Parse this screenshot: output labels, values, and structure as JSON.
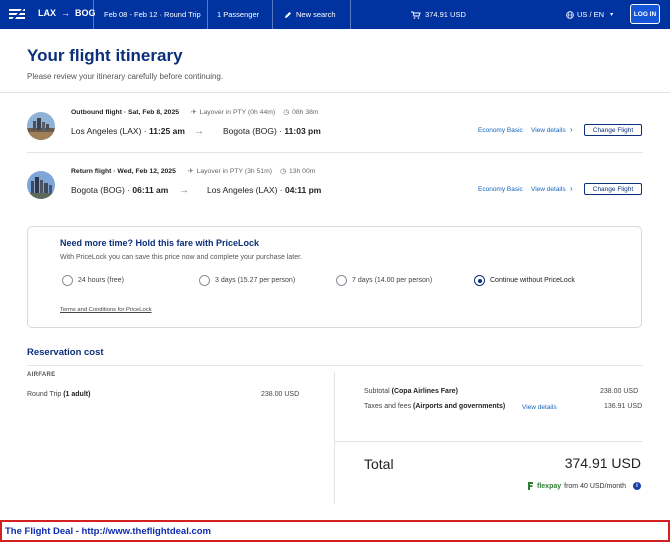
{
  "header": {
    "origin": "LAX",
    "destination": "BOG",
    "dates": "Feb 08 - Feb 12 · Round Trip",
    "passengers": "1 Passenger",
    "new_search": "New search",
    "cart_total": "374.91 USD",
    "locale": "US / EN",
    "login": "LOG IN"
  },
  "page": {
    "title": "Your flight itinerary",
    "subtitle": "Please review your itinerary carefully before continuing."
  },
  "flights": [
    {
      "label": "Outbound flight · Sat, Feb 8, 2025",
      "layover": "Layover in PTY (0h 44m)",
      "duration": "08h 38m",
      "depart": "Los Angeles (LAX) · ",
      "depart_time": "11:25 am",
      "arrive": "Bogota (BOG) · ",
      "arrive_time": "11:03 pm",
      "fare": "Economy Basic",
      "view_details": "View details",
      "change": "Change Flight"
    },
    {
      "label": "Return flight · Wed, Feb 12, 2025",
      "layover": "Layover in PTY (3h 51m)",
      "duration": "13h 00m",
      "depart": "Bogota (BOG) · ",
      "depart_time": "06:11 am",
      "arrive": "Los Angeles (LAX) · ",
      "arrive_time": "04:11 pm",
      "fare": "Economy Basic",
      "view_details": "View details",
      "change": "Change Flight"
    }
  ],
  "pricelock": {
    "title": "Need more time? Hold this fare with PriceLock",
    "subtitle": "With PriceLock you can save this price now and complete your purchase later.",
    "options": [
      {
        "label": "24 hours (free)",
        "selected": false
      },
      {
        "label": "3 days (15.27 per person)",
        "selected": false
      },
      {
        "label": "7 days (14.00 per person)",
        "selected": false
      },
      {
        "label": "Continue without PriceLock",
        "selected": true
      }
    ],
    "terms": "Terms and Conditions for PriceLock"
  },
  "reservation": {
    "title": "Reservation cost",
    "airfare_heading": "AIRFARE",
    "round_trip_label": "Round Trip",
    "round_trip_qty": "(1 adult)",
    "round_trip_price": "238.00 USD",
    "subtotal_label": "Subtotal",
    "subtotal_note": "(Copa Airlines Fare)",
    "subtotal_price": "238.00 USD",
    "taxes_label": "Taxes and fees",
    "taxes_note": "(Airports and governments)",
    "taxes_view": "View details",
    "taxes_price": "136.91 USD",
    "total_label": "Total",
    "total_price": "374.91 USD",
    "flexpay_brand": "flexpay",
    "flexpay_text": "from 40 USD/month"
  },
  "footer": {
    "text": "The Flight Deal - http://www.theflightdeal.com"
  },
  "colors": {
    "header_bg": "#0032a0",
    "brand_navy": "#0b2f7a",
    "link_blue": "#1565c0",
    "footer_border": "#d32020",
    "footer_text": "#0d2bb0"
  }
}
